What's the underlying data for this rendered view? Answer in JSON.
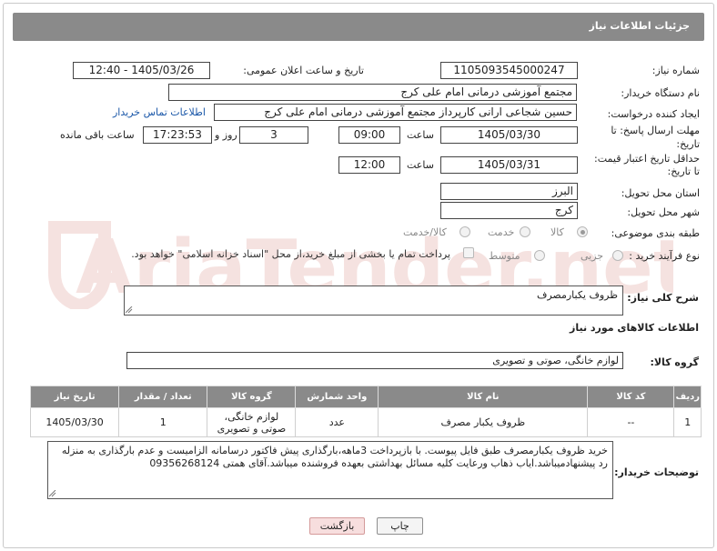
{
  "header": {
    "title": "جزئیات اطلاعات نیاز"
  },
  "form": {
    "need_number": {
      "label": "شماره نیاز:",
      "value": "1105093545000247"
    },
    "announce_datetime": {
      "label": "تاریخ و ساعت اعلان عمومی:",
      "value": "1405/03/26 - 12:40"
    },
    "buyer_org": {
      "label": "نام دستگاه خریدار:",
      "value": "مجتمع آموزشی درمانی امام علی کرج"
    },
    "requester": {
      "label": "ایجاد کننده درخواست:",
      "value": "حسین شجاعی ارانی کارپرداز مجتمع آموزشی درمانی امام علی کرج",
      "contact_link": "اطلاعات تماس خریدار"
    },
    "deadline": {
      "label_line1": "مهلت ارسال پاسخ: تا",
      "label_line2": "تاریخ:",
      "date": "1405/03/30",
      "time_label": "ساعت",
      "time": "09:00",
      "days": "3",
      "days_label": "روز و",
      "remaining": "17:23:53",
      "remaining_label": "ساعت باقی مانده"
    },
    "price_validity": {
      "label_line1": "حداقل تاریخ اعتبار قیمت:",
      "label_line2": "تا تاریخ:",
      "date": "1405/03/31",
      "time_label": "ساعت",
      "time": "12:00"
    },
    "province": {
      "label": "استان محل تحویل:",
      "value": "البرز"
    },
    "city": {
      "label": "شهر محل تحویل:",
      "value": "کرج"
    },
    "category": {
      "label": "طبقه بندی موضوعی:",
      "options": [
        "کالا",
        "خدمت",
        "کالا/خدمت"
      ],
      "selected": "کالا"
    },
    "purchase_process": {
      "label": "نوع فرآیند خرید :",
      "options": [
        "جزیی",
        "متوسط"
      ],
      "note": "پرداخت تمام یا بخشی از مبلغ خرید،از محل \"اسناد خزانه اسلامی\" خواهد بود."
    }
  },
  "summary": {
    "label": "شرح کلی نیاز:",
    "value": "ظروف یکبارمصرف"
  },
  "goods_section": {
    "title": "اطلاعات کالاهای مورد نیاز",
    "group_label": "گروه کالا:",
    "group_value": "لوازم خانگی، صوتی و تصویری"
  },
  "table": {
    "headers": [
      "ردیف",
      "کد کالا",
      "نام کالا",
      "واحد شمارش",
      "گروه کالا",
      "تعداد / مقدار",
      "تاریخ نیاز"
    ],
    "rows": [
      {
        "row": "1",
        "code": "--",
        "name": "ظروف یکبار مصرف",
        "unit": "عدد",
        "group_line1": "لوازم خانگی،",
        "group_line2": "صوتی و تصویری",
        "qty": "1",
        "date": "1405/03/30"
      }
    ]
  },
  "buyer_notes": {
    "label": "توضیحات خریدار:",
    "value": "خرید ظروف یکبارمصرف طبق فایل پیوست. با بازپرداخت 3ماهه،بارگذاری پیش فاکتور درسامانه الزامیست و عدم بارگذاری به منزله رد پیشنهادمیباشد.ایاب ذهاب ورعایت کلیه مسائل بهداشتی بعهده فروشنده میباشد.آقای همتی 09356268124"
  },
  "buttons": {
    "print": "چاپ",
    "back": "بازگشت"
  },
  "watermark": {
    "text": "AriaTender.net"
  },
  "colors": {
    "header": "#8a8a8a",
    "link": "#1a57a8",
    "back_button": "#f7dede",
    "watermark": "#c0392b"
  }
}
